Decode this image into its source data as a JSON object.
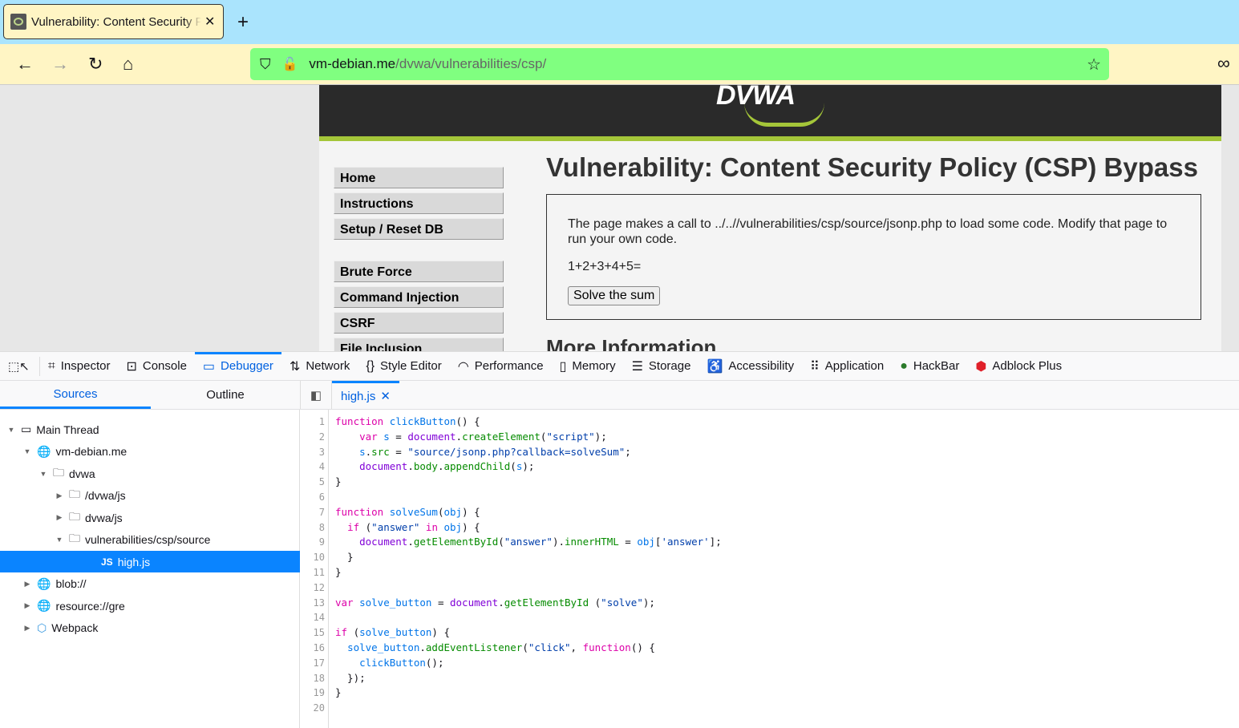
{
  "browser": {
    "tab_title": "Vulnerability: Content Security Policy (CSP) Bypass",
    "url_host": "vm-debian.me",
    "url_path": "/dvwa/vulnerabilities/csp/"
  },
  "dvwa": {
    "logo": "DVWA",
    "menu": [
      "Home",
      "Instructions",
      "Setup / Reset DB",
      "Brute Force",
      "Command Injection",
      "CSRF",
      "File Inclusion"
    ],
    "title": "Vulnerability: Content Security Policy (CSP) Bypass",
    "description": "The page makes a call to ../..//vulnerabilities/csp/source/jsonp.php to load some code. Modify that page to run your own code.",
    "sum": "1+2+3+4+5=",
    "solve_button": "Solve the sum",
    "more_info": "More Information"
  },
  "devtools": {
    "tabs": [
      "Inspector",
      "Console",
      "Debugger",
      "Network",
      "Style Editor",
      "Performance",
      "Memory",
      "Storage",
      "Accessibility",
      "Application",
      "HackBar",
      "Adblock Plus"
    ],
    "active_tab": "Debugger",
    "panes": {
      "sources": "Sources",
      "outline": "Outline"
    },
    "open_file": "high.js",
    "tree": [
      {
        "label": "Main Thread",
        "depth": 0,
        "icon": "window-icon",
        "expanded": true
      },
      {
        "label": "vm-debian.me",
        "depth": 1,
        "icon": "globe-icon",
        "expanded": true
      },
      {
        "label": "dvwa",
        "depth": 2,
        "icon": "folder-icon",
        "expanded": true
      },
      {
        "label": "/dvwa/js",
        "depth": 3,
        "icon": "folder-icon",
        "expanded": false
      },
      {
        "label": "dvwa/js",
        "depth": 3,
        "icon": "folder-icon",
        "expanded": false
      },
      {
        "label": "vulnerabilities/csp/source",
        "depth": 3,
        "icon": "folder-icon",
        "expanded": true
      },
      {
        "label": "high.js",
        "depth": 5,
        "icon": "js-icon",
        "selected": true
      },
      {
        "label": "blob://",
        "depth": 1,
        "icon": "globe-icon",
        "expanded": false
      },
      {
        "label": "resource://gre",
        "depth": 1,
        "icon": "globe-icon",
        "expanded": false
      },
      {
        "label": "Webpack",
        "depth": 1,
        "icon": "webpack-icon",
        "expanded": false
      }
    ],
    "code": [
      [
        [
          "k",
          "function "
        ],
        [
          "f",
          "clickButton"
        ],
        [
          "p",
          "() {"
        ]
      ],
      [
        [
          "p",
          "    "
        ],
        [
          "k",
          "var "
        ],
        [
          "v",
          "s"
        ],
        [
          "p",
          " = "
        ],
        [
          "d",
          "document"
        ],
        [
          "p",
          "."
        ],
        [
          "m",
          "createElement"
        ],
        [
          "p",
          "("
        ],
        [
          "s",
          "\"script\""
        ],
        [
          "p",
          ");"
        ]
      ],
      [
        [
          "p",
          "    "
        ],
        [
          "v",
          "s"
        ],
        [
          "p",
          "."
        ],
        [
          "m",
          "src"
        ],
        [
          "p",
          " = "
        ],
        [
          "s",
          "\"source/jsonp.php?callback=solveSum\""
        ],
        [
          "p",
          ";"
        ]
      ],
      [
        [
          "p",
          "    "
        ],
        [
          "d",
          "document"
        ],
        [
          "p",
          "."
        ],
        [
          "m",
          "body"
        ],
        [
          "p",
          "."
        ],
        [
          "m",
          "appendChild"
        ],
        [
          "p",
          "("
        ],
        [
          "v",
          "s"
        ],
        [
          "p",
          ");"
        ]
      ],
      [
        [
          "p",
          "}"
        ]
      ],
      [],
      [
        [
          "k",
          "function "
        ],
        [
          "f",
          "solveSum"
        ],
        [
          "p",
          "("
        ],
        [
          "v",
          "obj"
        ],
        [
          "p",
          ") {"
        ]
      ],
      [
        [
          "p",
          "  "
        ],
        [
          "k",
          "if "
        ],
        [
          "p",
          "("
        ],
        [
          "s",
          "\"answer\""
        ],
        [
          "k",
          " in "
        ],
        [
          "v",
          "obj"
        ],
        [
          "p",
          ") {"
        ]
      ],
      [
        [
          "p",
          "    "
        ],
        [
          "d",
          "document"
        ],
        [
          "p",
          "."
        ],
        [
          "m",
          "getElementById"
        ],
        [
          "p",
          "("
        ],
        [
          "s",
          "\"answer\""
        ],
        [
          "p",
          ")."
        ],
        [
          "m",
          "innerHTML"
        ],
        [
          "p",
          " = "
        ],
        [
          "v",
          "obj"
        ],
        [
          "p",
          "["
        ],
        [
          "s",
          "'answer'"
        ],
        [
          "p",
          "];"
        ]
      ],
      [
        [
          "p",
          "  }"
        ]
      ],
      [
        [
          "p",
          "}"
        ]
      ],
      [],
      [
        [
          "k",
          "var "
        ],
        [
          "v",
          "solve_button"
        ],
        [
          "p",
          " = "
        ],
        [
          "d",
          "document"
        ],
        [
          "p",
          "."
        ],
        [
          "m",
          "getElementById"
        ],
        [
          "p",
          " ("
        ],
        [
          "s",
          "\"solve\""
        ],
        [
          "p",
          ");"
        ]
      ],
      [],
      [
        [
          "k",
          "if "
        ],
        [
          "p",
          "("
        ],
        [
          "v",
          "solve_button"
        ],
        [
          "p",
          ") {"
        ]
      ],
      [
        [
          "p",
          "  "
        ],
        [
          "v",
          "solve_button"
        ],
        [
          "p",
          "."
        ],
        [
          "m",
          "addEventListener"
        ],
        [
          "p",
          "("
        ],
        [
          "s",
          "\"click\""
        ],
        [
          "p",
          ", "
        ],
        [
          "k",
          "function"
        ],
        [
          "p",
          "() {"
        ]
      ],
      [
        [
          "p",
          "    "
        ],
        [
          "v",
          "clickButton"
        ],
        [
          "p",
          "();"
        ]
      ],
      [
        [
          "p",
          "  });"
        ]
      ],
      [
        [
          "p",
          "}"
        ]
      ],
      []
    ]
  },
  "colors": {
    "accent": "#0a84ff",
    "url_bar": "#80ff80",
    "toolbar": "#fff5c4",
    "tabstrip": "#aae4fd",
    "dvwa_green": "#a4c639"
  }
}
